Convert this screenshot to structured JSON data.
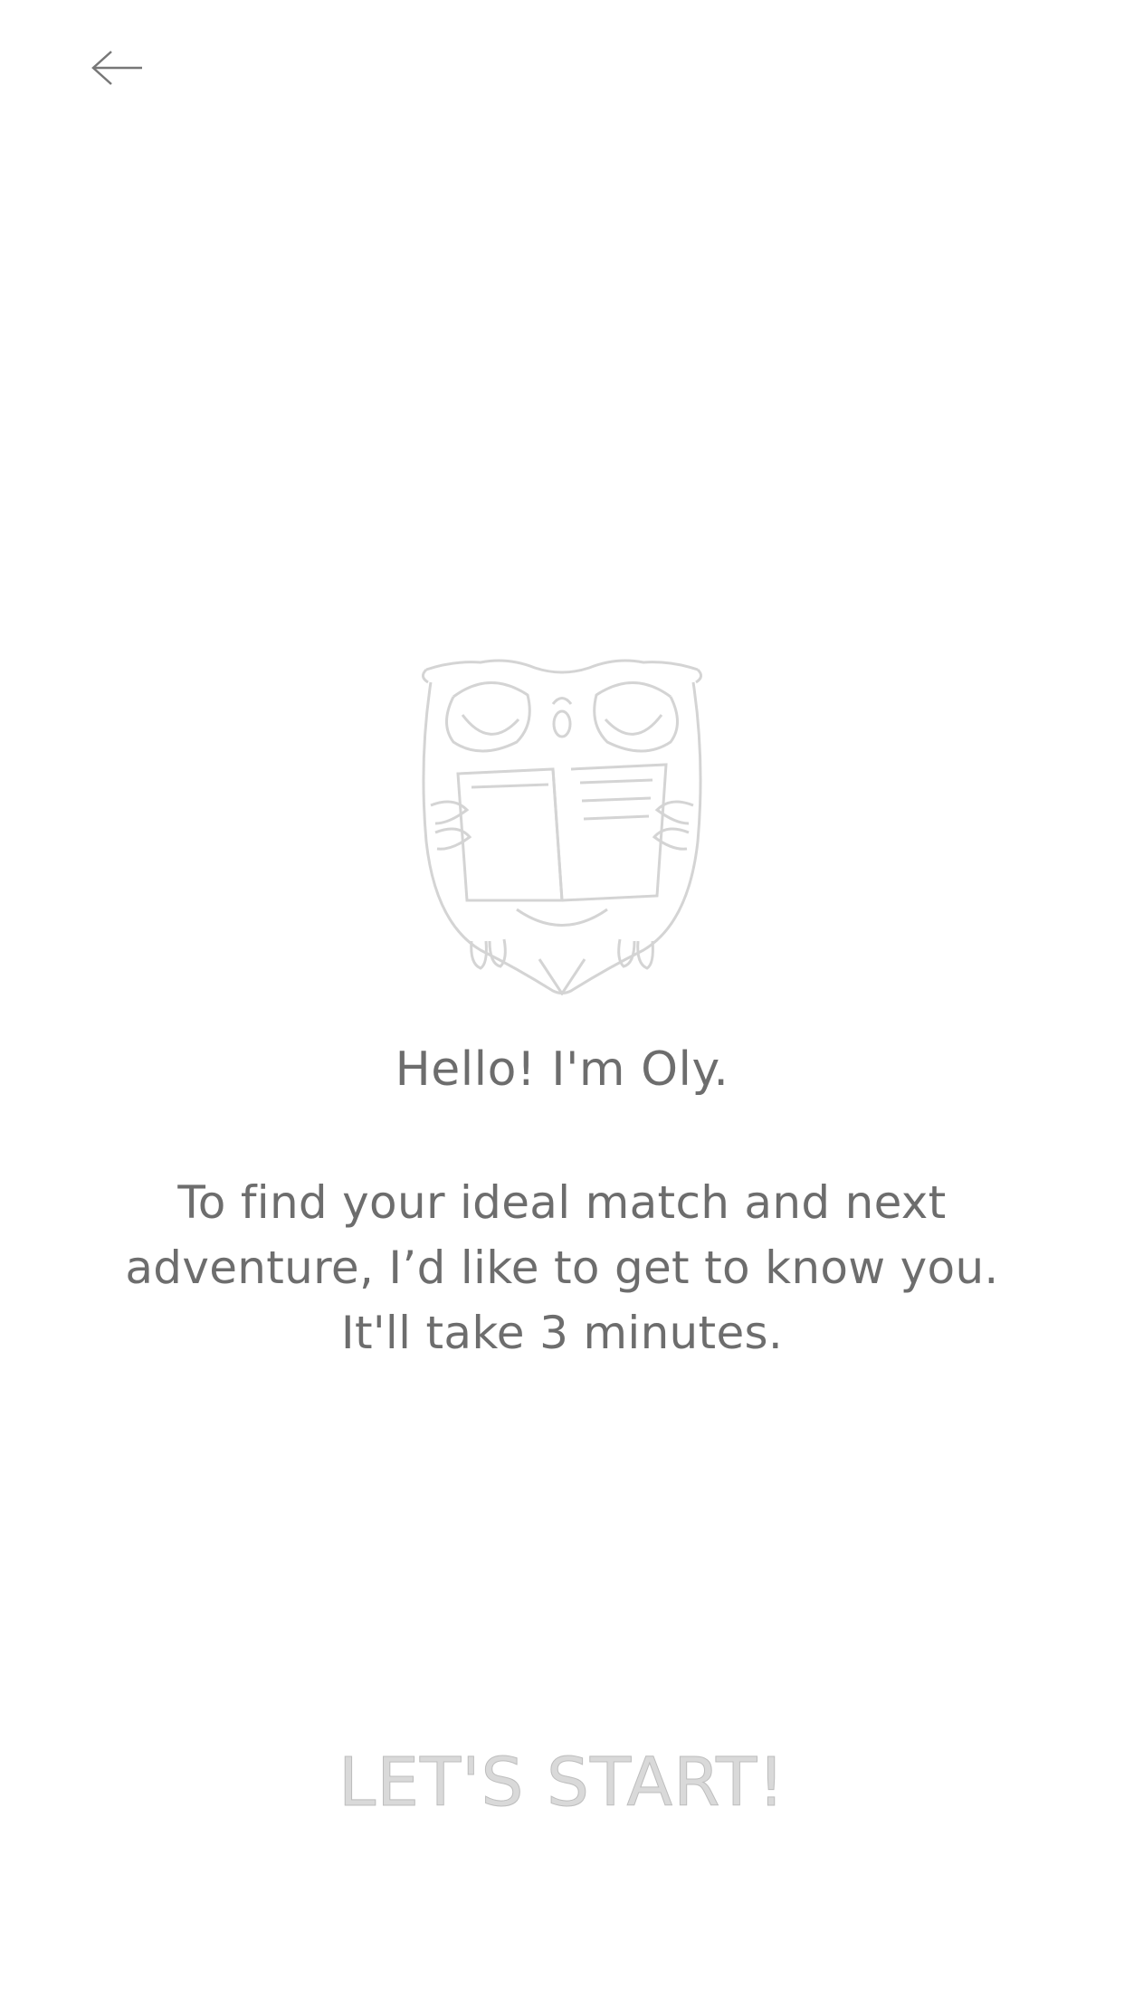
{
  "nav": {
    "back_icon": "arrow-left-icon"
  },
  "mascot": {
    "icon": "owl-reading-book-icon"
  },
  "content": {
    "greeting": "Hello! I'm Oly.",
    "intro_lines": [
      "To find your ideal match and next",
      "adventure, I’d like to get to know you.",
      "It'll take 3 minutes."
    ]
  },
  "actions": {
    "start_label": "LET'S START!"
  },
  "colors": {
    "background": "#ffffff",
    "text": "#6d6d6d",
    "button_text_disabled": "#d9d9d9"
  }
}
